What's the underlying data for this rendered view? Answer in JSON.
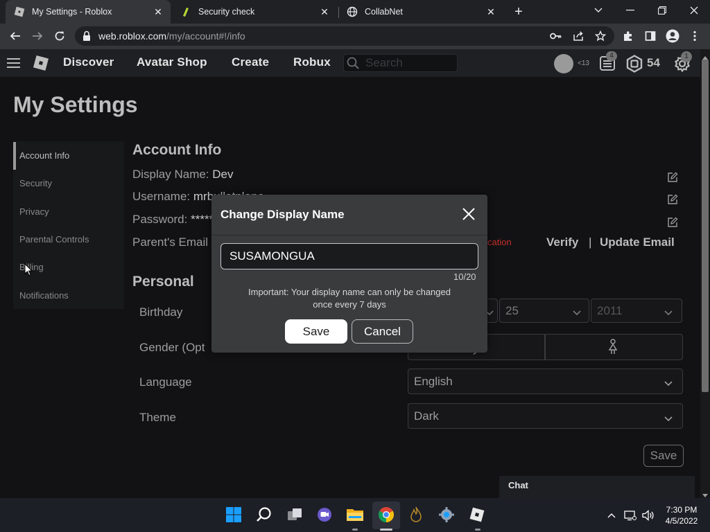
{
  "browser": {
    "tabs": [
      {
        "title": "My Settings - Roblox",
        "active": true
      },
      {
        "title": "Security check",
        "active": false
      },
      {
        "title": "CollabNet",
        "active": false
      }
    ],
    "new_tab_glyph": "+",
    "url_host": "web.roblox.com",
    "url_path": "/my/account#!/info"
  },
  "header": {
    "nav": [
      "Discover",
      "Avatar Shop",
      "Create",
      "Robux"
    ],
    "search_placeholder": "Search",
    "age_tag": "<13",
    "notifications_badge": "4",
    "robux_count": "54",
    "settings_badge": "1"
  },
  "page": {
    "title": "My Settings",
    "sidebar": [
      "Account Info",
      "Security",
      "Privacy",
      "Parental Controls",
      "Billing",
      "Notifications"
    ],
    "account_info": {
      "heading": "Account Info",
      "display_name_label": "Display Name:",
      "display_name_value": "Dev",
      "username_label": "Username:",
      "username_value": "mrbulletplane",
      "password_label": "Password:",
      "password_value": "********",
      "parents_email_label": "Parent's Email",
      "verification_text": "cation",
      "verify_link": "Verify",
      "separator": "|",
      "update_email_link": "Update Email"
    },
    "personal": {
      "heading": "Personal",
      "birthday_label": "Birthday",
      "birthday_day": "25",
      "birthday_year": "2011",
      "gender_label": "Gender (Opt",
      "gender_male_partial": "y",
      "language_label": "Language",
      "language_value": "English",
      "theme_label": "Theme",
      "theme_value": "Dark",
      "save_label": "Save"
    }
  },
  "modal": {
    "title": "Change Display Name",
    "input_value": "SUSAMONGUA",
    "char_count": "10/20",
    "note_line1": "Important: Your display name can only be changed",
    "note_line2": "once every 7 days",
    "save_label": "Save",
    "cancel_label": "Cancel"
  },
  "chat": {
    "label": "Chat"
  },
  "taskbar": {
    "time": "7:30 PM",
    "date": "4/5/2022"
  },
  "colors": {
    "modal_bg": "#393b3d",
    "page_bg": "#121215",
    "error_red": "#c4302b",
    "win_blue": "#1a9fff"
  }
}
